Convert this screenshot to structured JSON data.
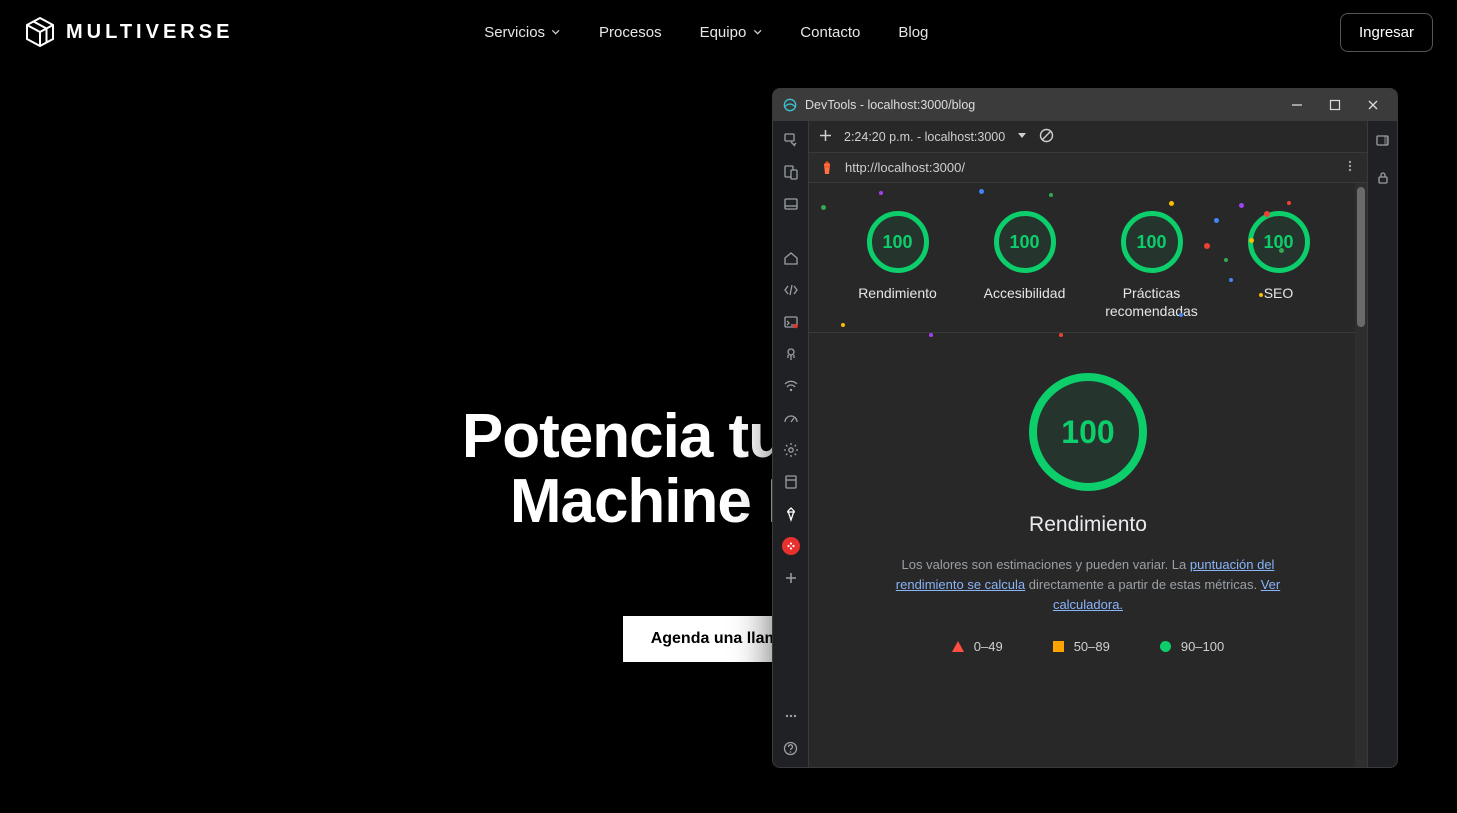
{
  "site": {
    "brand": "MULTIVERSE",
    "nav": {
      "servicios": "Servicios",
      "procesos": "Procesos",
      "equipo": "Equipo",
      "contacto": "Contacto",
      "blog": "Blog"
    },
    "login": "Ingresar",
    "hero_line1": "Potencia tu negoci",
    "hero_line2": "Machine Learni",
    "cta": "Agenda una llamada"
  },
  "devtools": {
    "title": "DevTools - localhost:3000/blog",
    "toolbar_time": "2:24:20 p.m. - localhost:3000",
    "url": "http://localhost:3000/",
    "gauges": [
      {
        "score": "100",
        "label": "Rendimiento"
      },
      {
        "score": "100",
        "label": "Accesibilidad"
      },
      {
        "score": "100",
        "label": "Prácticas\nrecomendadas"
      },
      {
        "score": "100",
        "label": "SEO"
      }
    ],
    "big": {
      "score": "100",
      "title": "Rendimiento"
    },
    "desc_prefix": "Los valores son estimaciones y pueden variar. La ",
    "desc_link1": "puntuación del rendimiento se calcula",
    "desc_mid": " directamente a partir de estas métricas. ",
    "desc_link2": "Ver calculadora.",
    "legend": {
      "low": "0–49",
      "mid": "50–89",
      "high": "90–100"
    }
  }
}
